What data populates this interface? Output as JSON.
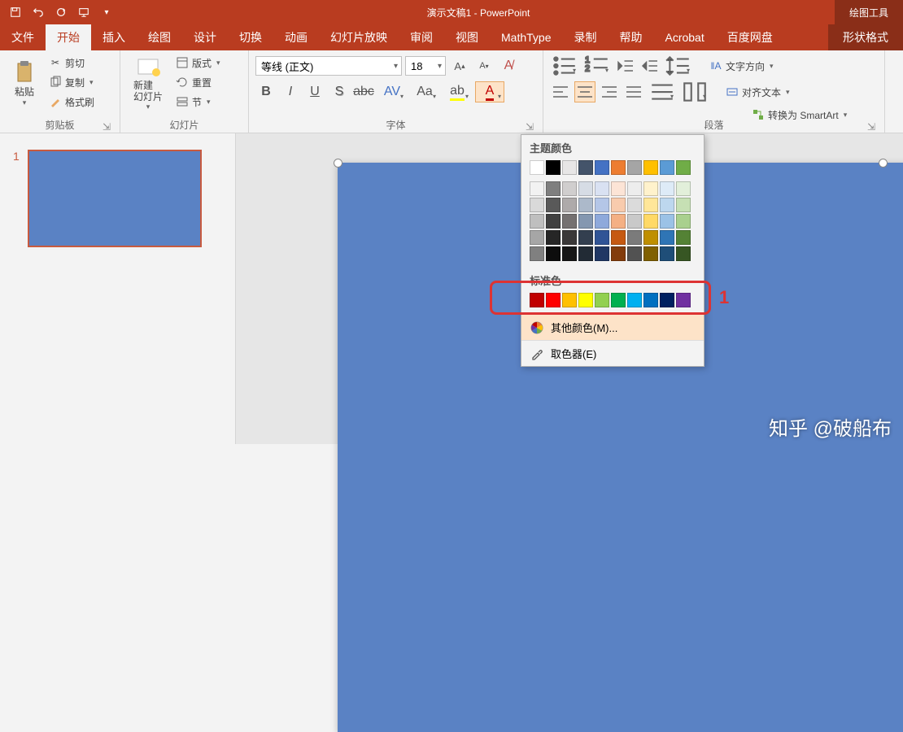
{
  "title": "演示文稿1 - PowerPoint",
  "tool_tab": "绘图工具",
  "tool_subtab": "形状格式",
  "tabs": [
    "文件",
    "开始",
    "插入",
    "绘图",
    "设计",
    "切换",
    "动画",
    "幻灯片放映",
    "审阅",
    "视图",
    "MathType",
    "录制",
    "帮助",
    "Acrobat",
    "百度网盘"
  ],
  "active_tab": "开始",
  "groups": {
    "clipboard": {
      "label": "剪贴板",
      "paste": "粘贴",
      "cut": "剪切",
      "copy": "复制",
      "format_painter": "格式刷"
    },
    "slides": {
      "label": "幻灯片",
      "new_slide": "新建\n幻灯片",
      "layout": "版式",
      "reset": "重置",
      "section": "节"
    },
    "font": {
      "label": "字体",
      "name": "等线 (正文)",
      "size": "18"
    },
    "paragraph": {
      "label": "段落",
      "text_direction": "文字方向",
      "align_text": "对齐文本",
      "smartart": "转换为 SmartArt"
    }
  },
  "thumb_number": "1",
  "color_dd": {
    "theme_title": "主题颜色",
    "standard_title": "标准色",
    "more_colors": "其他颜色(M)...",
    "eyedropper": "取色器(E)",
    "theme_row": [
      "#ffffff",
      "#000000",
      "#e7e6e6",
      "#44546a",
      "#4472c4",
      "#ed7d31",
      "#a5a5a5",
      "#ffc000",
      "#5b9bd5",
      "#70ad47"
    ],
    "theme_shades": [
      [
        "#f2f2f2",
        "#7f7f7f",
        "#d0cece",
        "#d6dce5",
        "#d9e1f2",
        "#fce4d6",
        "#ededed",
        "#fff2cc",
        "#deebf7",
        "#e2efda"
      ],
      [
        "#d9d9d9",
        "#595959",
        "#aeaaaa",
        "#acb9ca",
        "#b4c6e7",
        "#f8cbad",
        "#dbdbdb",
        "#ffe699",
        "#bdd7ee",
        "#c6e0b4"
      ],
      [
        "#bfbfbf",
        "#404040",
        "#757171",
        "#8497b0",
        "#8ea9db",
        "#f4b084",
        "#c9c9c9",
        "#ffd966",
        "#9bc2e6",
        "#a9d08e"
      ],
      [
        "#a6a6a6",
        "#262626",
        "#3a3838",
        "#333f4f",
        "#305496",
        "#c65911",
        "#7b7b7b",
        "#bf8f00",
        "#2f75b5",
        "#548235"
      ],
      [
        "#808080",
        "#0d0d0d",
        "#161616",
        "#222b35",
        "#203764",
        "#833c0c",
        "#525252",
        "#806000",
        "#1f4e78",
        "#375623"
      ]
    ],
    "standard_row": [
      "#c00000",
      "#ff0000",
      "#ffc000",
      "#ffff00",
      "#92d050",
      "#00b050",
      "#00b0f0",
      "#0070c0",
      "#002060",
      "#7030a0"
    ]
  },
  "annotation_number": "1",
  "watermark": "知乎 @破船布"
}
